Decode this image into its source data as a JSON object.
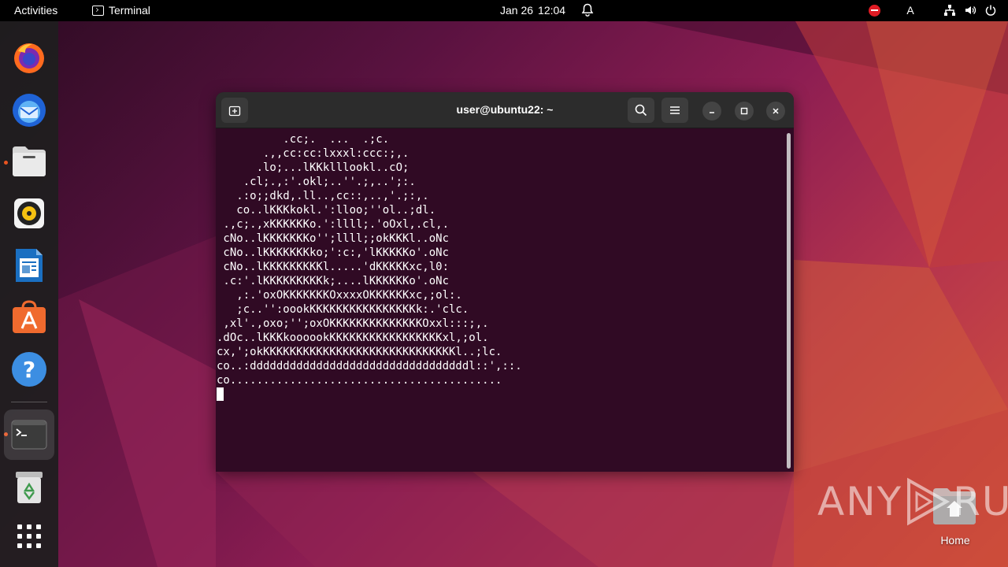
{
  "topbar": {
    "activities": "Activities",
    "app_name": "Terminal",
    "date": "Jan 26",
    "time": "12:04",
    "input_method": "A"
  },
  "dock": {
    "items": [
      {
        "name": "firefox",
        "icon": "firefox-icon"
      },
      {
        "name": "thunderbird",
        "icon": "thunderbird-icon"
      },
      {
        "name": "files",
        "icon": "files-icon",
        "running": true
      },
      {
        "name": "rhythmbox",
        "icon": "rhythmbox-icon"
      },
      {
        "name": "libreoffice-writer",
        "icon": "writer-icon"
      },
      {
        "name": "app-center",
        "icon": "app-center-icon"
      },
      {
        "name": "help",
        "icon": "help-icon"
      },
      {
        "name": "terminal",
        "icon": "terminal-icon",
        "running": true,
        "active": true
      },
      {
        "name": "trash",
        "icon": "trash-icon"
      },
      {
        "name": "show-apps",
        "icon": "app-grid-icon"
      }
    ]
  },
  "terminal": {
    "title": "user@ubuntu22: ~",
    "lines": [
      "          .cc;.  ...  .;c.",
      "       .,,cc:cc:lxxxl:ccc:;,.",
      "      .lo;...lKKklllookl..cO;",
      "    .cl;.,:'.okl;..''.;,..';:.",
      "   .:o;;dkd,.ll..,cc::,..,'.;:,.",
      "   co..lKKKkokl.':lloo;''ol..;dl.",
      " .,c;.,xKKKKKKo.':llll;.'oOxl,.cl,.",
      " cNo..lKKKKKKKo'';llll;;okKKKl..oNc",
      " cNo..lKKKKKKKko;':c:,'lKKKKKo'.oNc",
      " cNo..lKKKKKKKKKl.....'dKKKKKxc,l0:",
      " .c:'.lKKKKKKKKKk;....lKKKKKKo'.oNc",
      "   ,:.'oxOKKKKKKKOxxxxOKKKKKKxc,;ol:.",
      "   ;c..'':oookKKKKKKKKKKKKKKKKk:.'clc.",
      " ,xl'.,oxo;'';oxOKKKKKKKKKKKKKKOxxl:::;,.",
      ".dOc..lKKKkoooookKKKKKKKKKKKKKKKKKxl,;ol.",
      "cx,';okKKKKKKKKKKKKKKKKKKKKKKKKKKKKKl..;lc.",
      "co..:dddddddddddddddddddddddddddddddddl::',::.",
      "co.........................................",
      ""
    ]
  },
  "desktop": {
    "home_label": "Home"
  },
  "watermark": {
    "text_left": "ANY",
    "text_right": "RUN"
  }
}
